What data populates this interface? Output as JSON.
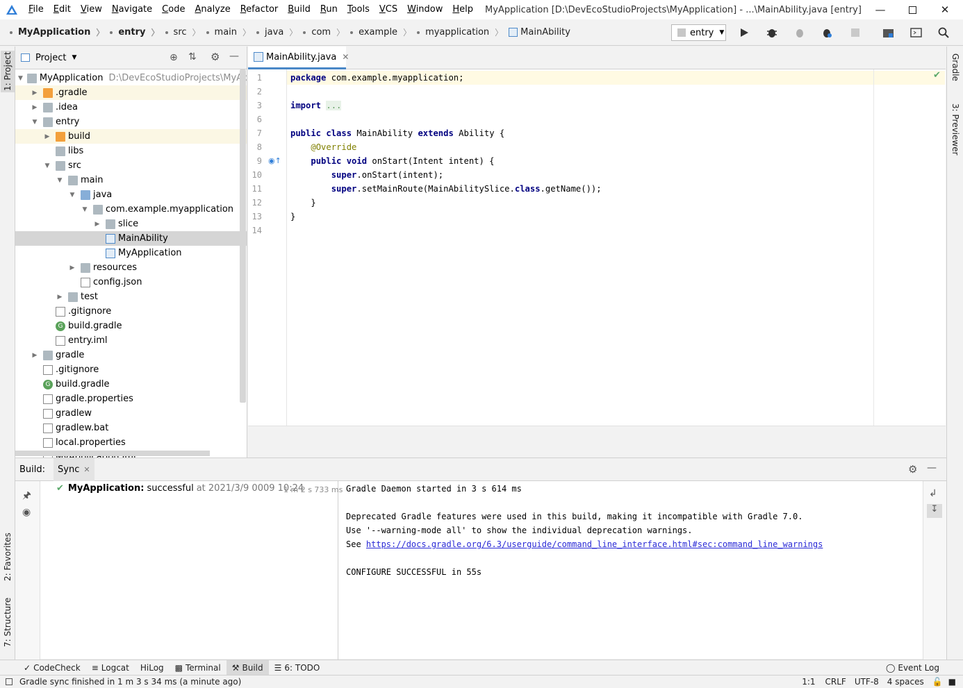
{
  "menubar": {
    "items": [
      "File",
      "Edit",
      "View",
      "Navigate",
      "Code",
      "Analyze",
      "Refactor",
      "Build",
      "Run",
      "Tools",
      "VCS",
      "Window",
      "Help"
    ],
    "window_title": "MyApplication [D:\\DevEcoStudioProjects\\MyApplication] - ...\\MainAbility.java [entry]"
  },
  "breadcrumb": [
    "MyApplication",
    "entry",
    "src",
    "main",
    "java",
    "com",
    "example",
    "myapplication",
    "MainAbility"
  ],
  "run_config": "entry",
  "left_strip": {
    "project": "1: Project",
    "favorites": "2: Favorites",
    "structure": "7: Structure"
  },
  "right_strip": {
    "gradle": "Gradle",
    "previewer": "3: Previewer"
  },
  "project_panel": {
    "title": "Project",
    "root_path": "D:\\DevEcoStudioProjects\\MyApplic",
    "tree": [
      {
        "label": "MyApplication",
        "depth": 0,
        "arrow": "open",
        "icon": "folder",
        "hint": true
      },
      {
        "label": ".gradle",
        "depth": 1,
        "arrow": "closed",
        "icon": "orange"
      },
      {
        "label": ".idea",
        "depth": 1,
        "arrow": "closed",
        "icon": "folder"
      },
      {
        "label": "entry",
        "depth": 1,
        "arrow": "open",
        "icon": "folder"
      },
      {
        "label": "build",
        "depth": 2,
        "arrow": "closed",
        "icon": "orange"
      },
      {
        "label": "libs",
        "depth": 2,
        "arrow": "none",
        "icon": "folder"
      },
      {
        "label": "src",
        "depth": 2,
        "arrow": "open",
        "icon": "folder"
      },
      {
        "label": "main",
        "depth": 3,
        "arrow": "open",
        "icon": "folder"
      },
      {
        "label": "java",
        "depth": 4,
        "arrow": "open",
        "icon": "blue"
      },
      {
        "label": "com.example.myapplication",
        "depth": 5,
        "arrow": "open",
        "icon": "folder"
      },
      {
        "label": "slice",
        "depth": 6,
        "arrow": "closed",
        "icon": "folder"
      },
      {
        "label": "MainAbility",
        "depth": 6,
        "arrow": "none",
        "icon": "java",
        "selected": true
      },
      {
        "label": "MyApplication",
        "depth": 6,
        "arrow": "none",
        "icon": "java"
      },
      {
        "label": "resources",
        "depth": 4,
        "arrow": "closed",
        "icon": "folder"
      },
      {
        "label": "config.json",
        "depth": 4,
        "arrow": "none",
        "icon": "file"
      },
      {
        "label": "test",
        "depth": 3,
        "arrow": "closed",
        "icon": "folder"
      },
      {
        "label": ".gitignore",
        "depth": 2,
        "arrow": "none",
        "icon": "file"
      },
      {
        "label": "build.gradle",
        "depth": 2,
        "arrow": "none",
        "icon": "gradle"
      },
      {
        "label": "entry.iml",
        "depth": 2,
        "arrow": "none",
        "icon": "file"
      },
      {
        "label": "gradle",
        "depth": 1,
        "arrow": "closed",
        "icon": "folder"
      },
      {
        "label": ".gitignore",
        "depth": 1,
        "arrow": "none",
        "icon": "file"
      },
      {
        "label": "build.gradle",
        "depth": 1,
        "arrow": "none",
        "icon": "gradle"
      },
      {
        "label": "gradle.properties",
        "depth": 1,
        "arrow": "none",
        "icon": "file"
      },
      {
        "label": "gradlew",
        "depth": 1,
        "arrow": "none",
        "icon": "file"
      },
      {
        "label": "gradlew.bat",
        "depth": 1,
        "arrow": "none",
        "icon": "file"
      },
      {
        "label": "local.properties",
        "depth": 1,
        "arrow": "none",
        "icon": "file"
      },
      {
        "label": "MyApplication.iml",
        "depth": 1,
        "arrow": "none",
        "icon": "file"
      }
    ]
  },
  "editor": {
    "tab": "MainAbility.java",
    "lines": [
      {
        "n": "1",
        "html": "<span class=\"kw\">package</span> com.example.myapplication;"
      },
      {
        "n": "2",
        "html": ""
      },
      {
        "n": "3",
        "html": "<span class=\"kw\">import</span> <span class=\"fold\">...</span>"
      },
      {
        "n": "6",
        "html": ""
      },
      {
        "n": "7",
        "html": "<span class=\"kw\">public class</span> MainAbility <span class=\"kw\">extends</span> Ability {"
      },
      {
        "n": "8",
        "html": "    <span class=\"ann\">@Override</span>"
      },
      {
        "n": "9",
        "html": "    <span class=\"kw\">public void</span> onStart(Intent intent) {"
      },
      {
        "n": "10",
        "html": "        <span class=\"kw\">super</span>.onStart(intent);"
      },
      {
        "n": "11",
        "html": "        <span class=\"kw\">super</span>.setMainRoute(MainAbilitySlice.<span class=\"kw\">class</span>.getName());"
      },
      {
        "n": "12",
        "html": "    }"
      },
      {
        "n": "13",
        "html": "}"
      },
      {
        "n": "14",
        "html": ""
      }
    ]
  },
  "build": {
    "label": "Build:",
    "tab": "Sync",
    "result_project": "MyApplication:",
    "result_status": "successful",
    "result_time": "at 2021/3/9 0009 10:24",
    "duration": "1 m 2 s 733 ms",
    "output": [
      "Gradle Daemon started in 3 s 614 ms",
      "",
      "Deprecated Gradle features were used in this build, making it incompatible with Gradle 7.0.",
      "Use '--warning-mode all' to show the individual deprecation warnings.",
      "See "
    ],
    "link": "https://docs.gradle.org/6.3/userguide/command_line_interface.html#sec:command_line_warnings",
    "configure": "CONFIGURE SUCCESSFUL in 55s"
  },
  "bottom_tabs": [
    "CodeCheck",
    "Logcat",
    "HiLog",
    "Terminal",
    "Build",
    "6: TODO"
  ],
  "event_log": "Event Log",
  "status": {
    "message": "Gradle sync finished in 1 m 3 s 34 ms (a minute ago)",
    "position": "1:1",
    "line_sep": "CRLF",
    "encoding": "UTF-8",
    "indent": "4 spaces"
  }
}
